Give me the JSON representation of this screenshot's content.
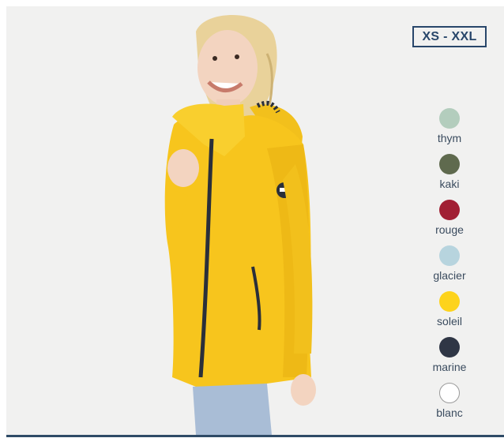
{
  "size_range": "XS - XXL",
  "colors": [
    {
      "label": "thym",
      "hex": "#b3cdbd"
    },
    {
      "label": "kaki",
      "hex": "#5f6a4e"
    },
    {
      "label": "rouge",
      "hex": "#a11f33"
    },
    {
      "label": "glacier",
      "hex": "#b7d4de"
    },
    {
      "label": "soleil",
      "hex": "#fdd31c"
    },
    {
      "label": "marine",
      "hex": "#2f3645"
    },
    {
      "label": "blanc",
      "hex": "#ffffff"
    }
  ],
  "product": {
    "jacket_color": "#f7c51d",
    "trim_color": "#2a2f3a",
    "image_icon": "model-in-yellow-raincoat"
  }
}
